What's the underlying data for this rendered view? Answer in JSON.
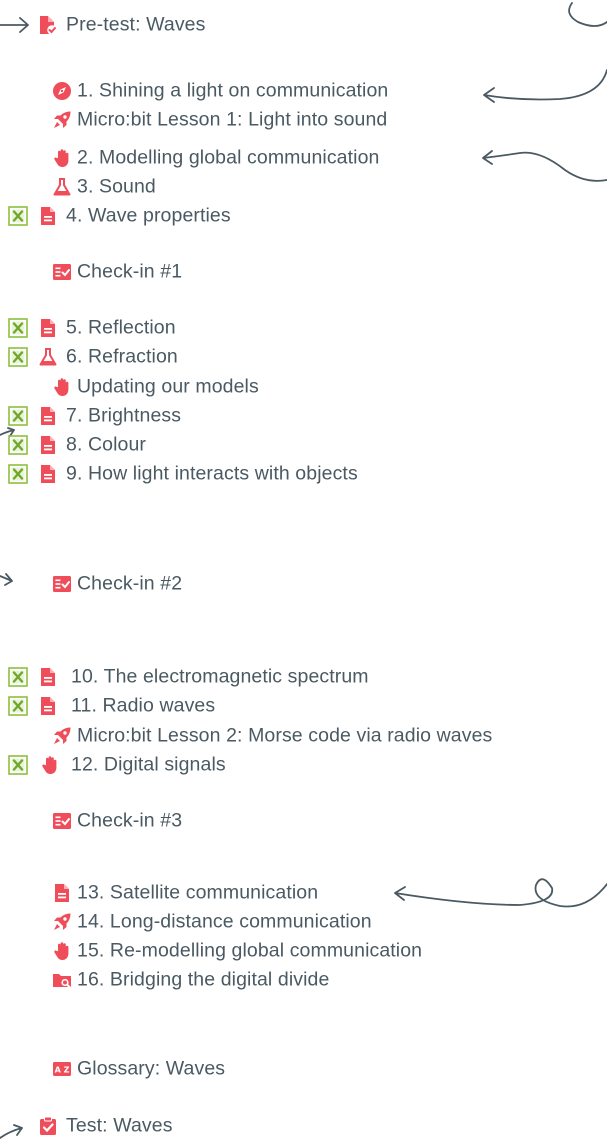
{
  "colors": {
    "text": "#4a5962",
    "accent": "#f04d5b",
    "excel": "#8cbf3f",
    "arrow": "#4a5962"
  },
  "items": {
    "pretest": {
      "label": "Pre-test: Waves",
      "icon": "file-check-icon"
    },
    "l1": {
      "label": "1. Shining a light on communication",
      "icon": "compass-icon"
    },
    "mb1": {
      "label": "Micro:bit Lesson 1: Light into sound",
      "icon": "rocket-icon"
    },
    "l2": {
      "label": "2. Modelling global communication",
      "icon": "hand-icon"
    },
    "l3": {
      "label": "3. Sound",
      "icon": "flask-icon"
    },
    "l4": {
      "label": "4. Wave properties",
      "icon": "document-icon",
      "excel_icon": true
    },
    "checkin1": {
      "label": "Check-in #1",
      "icon": "checklist-icon"
    },
    "l5": {
      "label": "5. Reflection",
      "icon": "document-icon",
      "excel_icon": true
    },
    "l6": {
      "label": "6. Refraction",
      "icon": "flask-icon",
      "excel_icon": true
    },
    "updating": {
      "label": "Updating our models",
      "icon": "hand-icon"
    },
    "l7": {
      "label": "7. Brightness",
      "icon": "document-icon",
      "excel_icon": true
    },
    "l8": {
      "label": "8. Colour",
      "icon": "document-icon",
      "excel_icon": true
    },
    "l9": {
      "label": "9. How light interacts with objects",
      "icon": "document-icon",
      "excel_icon": true
    },
    "checkin2": {
      "label": "Check-in #2",
      "icon": "checklist-icon"
    },
    "l10": {
      "label": "10. The electromagnetic spectrum",
      "icon": "document-icon",
      "excel_icon": true
    },
    "l11": {
      "label": "11. Radio waves",
      "icon": "document-icon",
      "excel_icon": true
    },
    "mb2": {
      "label": "Micro:bit Lesson 2: Morse code via radio waves",
      "icon": "rocket-icon"
    },
    "l12": {
      "label": "12. Digital signals",
      "icon": "hand-icon",
      "excel_icon": true
    },
    "checkin3": {
      "label": "Check-in #3",
      "icon": "checklist-icon"
    },
    "l13": {
      "label": "13. Satellite communication",
      "icon": "document-icon"
    },
    "l14": {
      "label": "14. Long-distance communication",
      "icon": "rocket-icon"
    },
    "l15": {
      "label": "15. Re-modelling global communication",
      "icon": "hand-icon"
    },
    "l16": {
      "label": "16. Bridging the digital divide",
      "icon": "folder-search-icon"
    },
    "glossary": {
      "label": "Glossary: Waves",
      "icon": "az-icon"
    },
    "test": {
      "label": "Test: Waves",
      "icon": "clipboard-check-icon"
    }
  }
}
